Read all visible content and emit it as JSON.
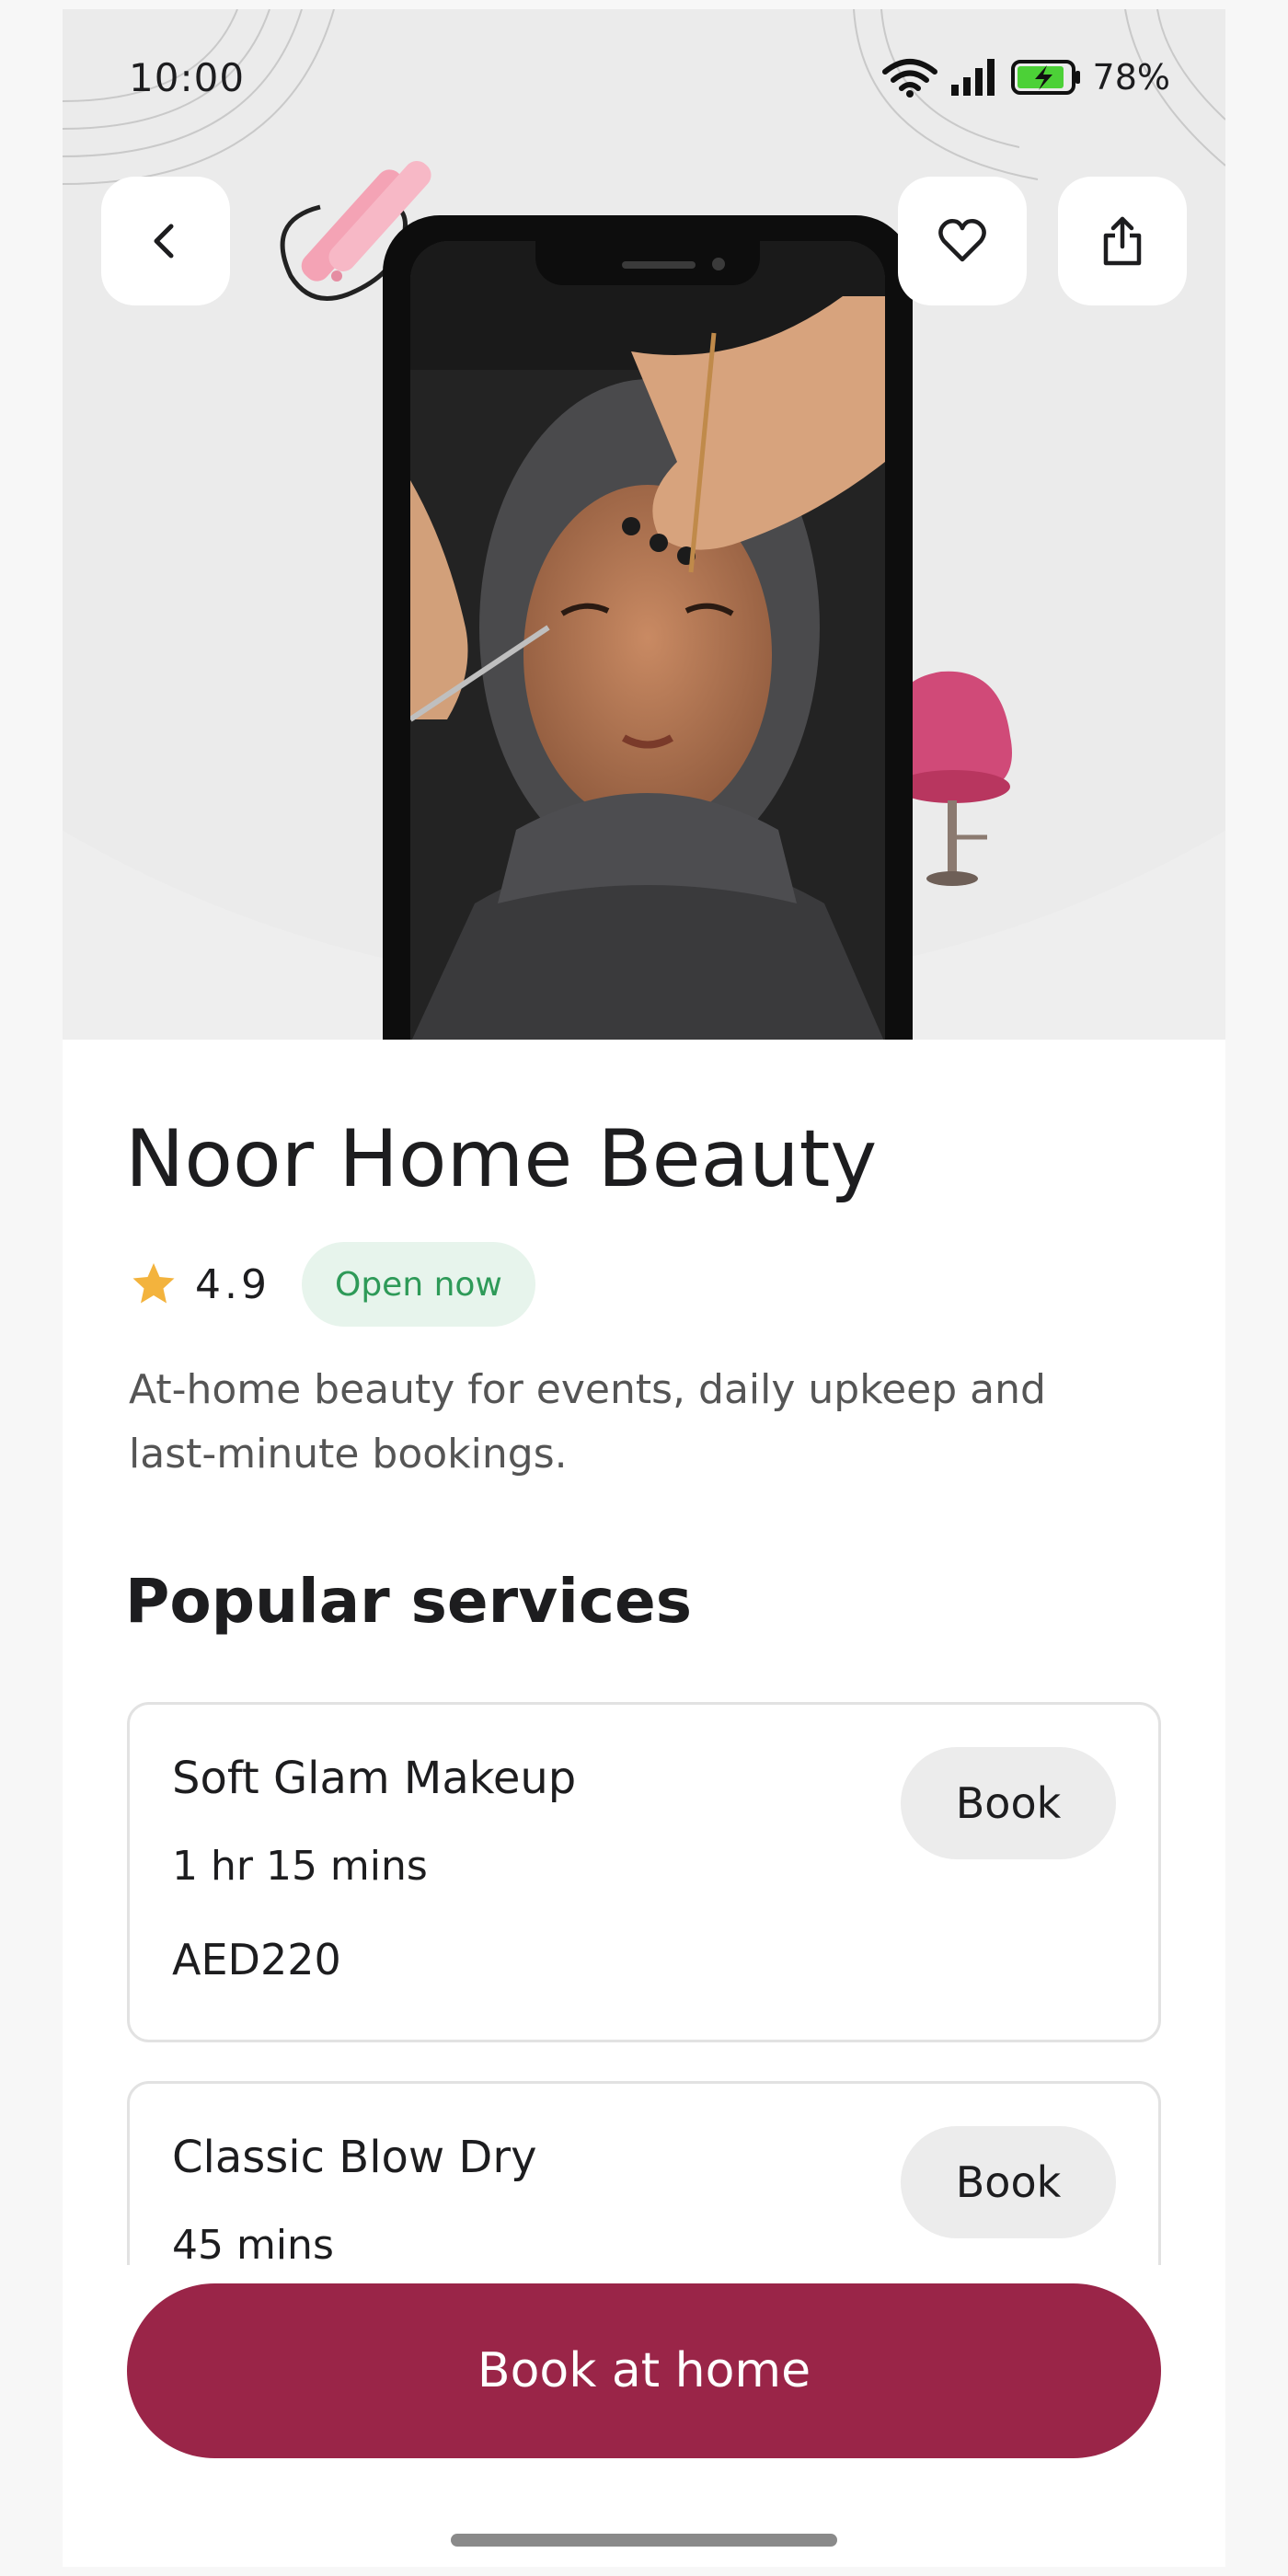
{
  "status_bar": {
    "time": "10:00",
    "battery": "78%",
    "icons": [
      "wifi-icon",
      "signal-icon",
      "battery-charging-icon"
    ]
  },
  "header": {
    "icons": [
      "back-chevron-icon",
      "heart-icon",
      "share-icon"
    ]
  },
  "business": {
    "name": "Noor Home Beauty",
    "rating": "4.9",
    "status": "Open now",
    "description": "At-home beauty for events, daily upkeep and last-minute bookings."
  },
  "services": {
    "title": "Popular services",
    "items": [
      {
        "name": "Soft Glam Makeup",
        "duration": "1 hr 15 mins",
        "price": "AED220",
        "button": "Book"
      },
      {
        "name": "Classic Blow Dry",
        "duration": "45 mins",
        "button": "Book"
      }
    ]
  },
  "cta": {
    "label": "Book at home"
  },
  "colors": {
    "brand": "#9a2548",
    "open_badge_bg": "#e7f4ec",
    "open_badge_text": "#2e9a58",
    "star": "#f3b33d"
  }
}
